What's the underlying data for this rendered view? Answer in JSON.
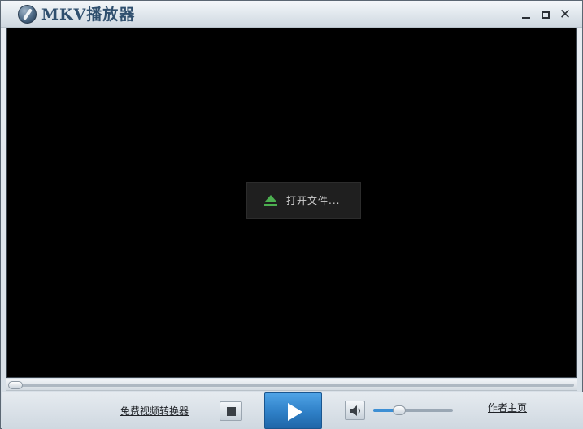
{
  "window": {
    "title": "MKV播放器",
    "controls": [
      "minimize-icon",
      "maximize-icon",
      "close-icon"
    ]
  },
  "video": {
    "open_file_label": "打开文件...",
    "open_file_icon": "eject-icon"
  },
  "playback": {
    "progress": 0.0
  },
  "controls": {
    "converter_link": "免费视频转换器",
    "author_link": "作者主页",
    "volume_level": 0.33,
    "icons": [
      "stop-icon",
      "play-icon",
      "speaker-icon"
    ]
  },
  "colors": {
    "play_button": "#2e7fc6",
    "eject_icon": "#4caf50",
    "video_background": "#000000"
  }
}
